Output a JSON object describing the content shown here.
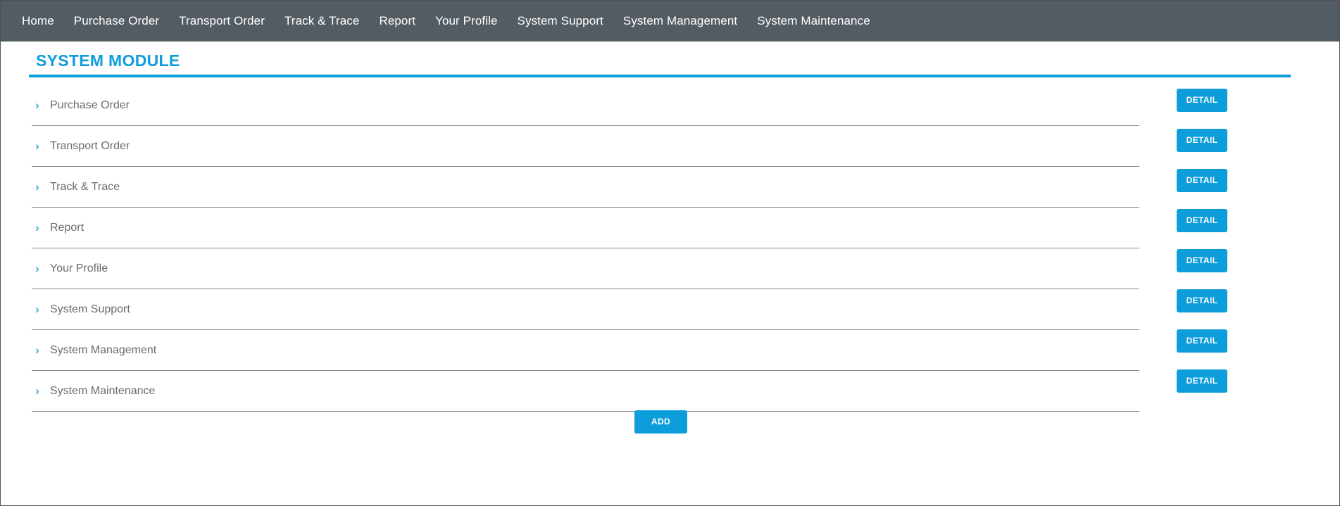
{
  "theme": {
    "navbar_bg": "#545c63",
    "accent_blue": "#0d9ddb",
    "chevron_blue": "#3eabe0",
    "label_gray": "#6b6b6b",
    "separator_gray": "#8a8a8a",
    "page_bg": "#ffffff"
  },
  "navbar": {
    "items": [
      {
        "label": "Home"
      },
      {
        "label": "Purchase Order"
      },
      {
        "label": "Transport Order"
      },
      {
        "label": "Track & Trace"
      },
      {
        "label": "Report"
      },
      {
        "label": "Your Profile"
      },
      {
        "label": "System Support"
      },
      {
        "label": "System Management"
      },
      {
        "label": "System Maintenance"
      }
    ]
  },
  "main": {
    "title": "SYSTEM MODULE",
    "chevron_glyph": "›",
    "detail_button_label": "DETAIL",
    "add_button_label": "ADD",
    "rows": [
      {
        "label": "Purchase Order",
        "detail_label": "DETAIL"
      },
      {
        "label": "Transport Order",
        "detail_label": "DETAIL"
      },
      {
        "label": "Track & Trace",
        "detail_label": "DETAIL"
      },
      {
        "label": "Report",
        "detail_label": "DETAIL"
      },
      {
        "label": "Your Profile",
        "detail_label": "DETAIL"
      },
      {
        "label": "System Support",
        "detail_label": "DETAIL"
      },
      {
        "label": "System Management",
        "detail_label": "DETAIL"
      },
      {
        "label": "System Maintenance",
        "detail_label": "DETAIL"
      }
    ]
  }
}
